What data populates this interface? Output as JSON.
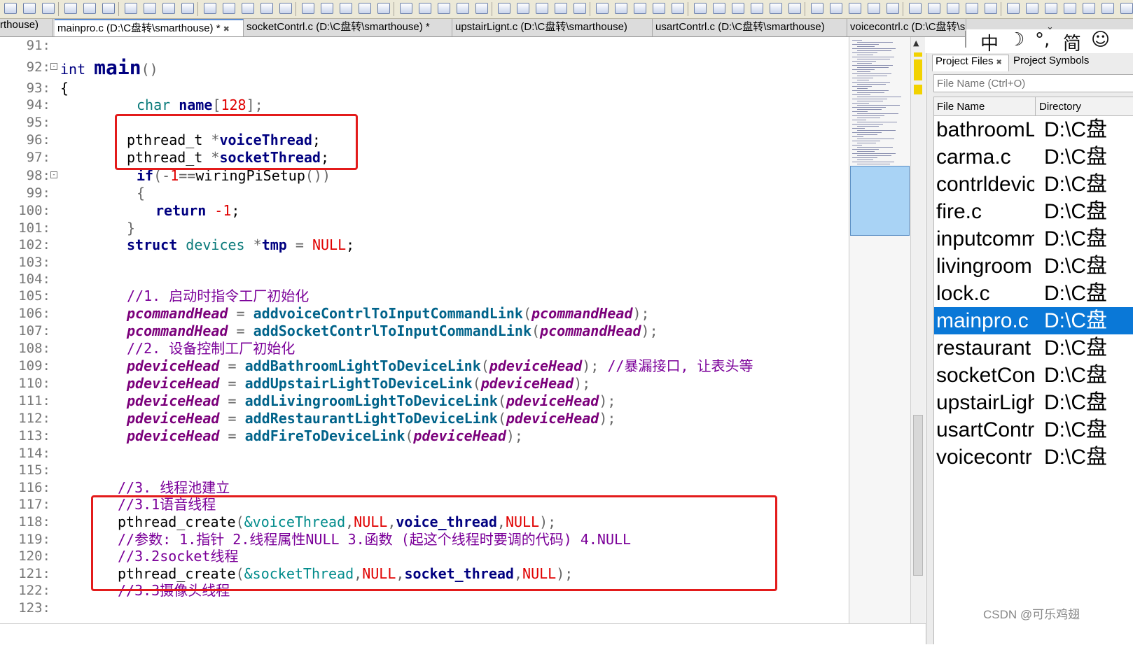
{
  "tabs": [
    {
      "label": "rthouse)",
      "active": false,
      "close": ""
    },
    {
      "label": "mainpro.c (D:\\C盘转\\smarthouse) *",
      "active": true,
      "close": "✖"
    },
    {
      "label": "socketContrl.c (D:\\C盘转\\smarthouse) *",
      "active": false,
      "close": ""
    },
    {
      "label": "upstairLignt.c (D:\\C盘转\\smarthouse)",
      "active": false,
      "close": ""
    },
    {
      "label": "usartContrl.c (D:\\C盘转\\smarthouse)",
      "active": false,
      "close": ""
    },
    {
      "label": "voicecontrl.c (D:\\C盘转\\smarthouse)",
      "active": false,
      "close": ""
    }
  ],
  "editor": {
    "line_numbers": [
      "91:",
      "92:",
      "93:",
      "94:",
      "95:",
      "96:",
      "97:",
      "98:",
      "99:",
      "100:",
      "101:",
      "102:",
      "103:",
      "104:",
      "105:",
      "106:",
      "107:",
      "108:",
      "109:",
      "110:",
      "111:",
      "112:",
      "113:",
      "114:",
      "115:",
      "116:",
      "117:",
      "118:",
      "119:",
      "120:",
      "121:",
      "122:",
      "123:"
    ],
    "code": {
      "l92": {
        "kw": "int",
        "fn": "main",
        "paren": "()"
      },
      "l93": "{",
      "l94": {
        "kw": "char",
        "id": "name",
        "br1": "[",
        "num": "128",
        "br2": "];"
      },
      "l96": {
        "ty": "pthread_t",
        "star": "*",
        "id": "voiceThread",
        "semi": ";"
      },
      "l97": {
        "ty": "pthread_t",
        "star": "*",
        "id": "socketThread",
        "semi": ";"
      },
      "l98": {
        "kw": "if",
        "p1": "(",
        "neg": "-",
        "num": "1",
        "eq": "==",
        "call": "wiringPiSetup",
        "p2": "())"
      },
      "l99": "{",
      "l100": {
        "kw": "return",
        "num": "-1",
        "semi": ";"
      },
      "l101": "}",
      "l102": {
        "kw": "struct",
        "ty": "devices",
        "star": "*",
        "id": "tmp",
        "eq": "=",
        "nul": "NULL",
        "semi": ";"
      },
      "l105": "//1. 启动时指令工厂初始化",
      "l106": {
        "v": "pcommandHead",
        "eq": "=",
        "fn": "addvoiceContrlToInputCommandLink",
        "p1": "(",
        "arg": "pcommandHead",
        "p2": ");"
      },
      "l107": {
        "v": "pcommandHead",
        "eq": "=",
        "fn": "addSocketContrlToInputCommandLink",
        "p1": "(",
        "arg": "pcommandHead",
        "p2": ");"
      },
      "l108": "//2. 设备控制工厂初始化",
      "l109": {
        "v": "pdeviceHead",
        "eq": "=",
        "fn": "addBathroomLightToDeviceLink",
        "p1": "(",
        "arg": "pdeviceHead",
        "p2": ");",
        "cmt": "//暴漏接口, 让表头等"
      },
      "l110": {
        "v": "pdeviceHead",
        "eq": "=",
        "fn": "addUpstairLightToDeviceLink",
        "p1": "(",
        "arg": "pdeviceHead",
        "p2": ");"
      },
      "l111": {
        "v": "pdeviceHead",
        "eq": "=",
        "fn": "addLivingroomLightToDeviceLink",
        "p1": "(",
        "arg": "pdeviceHead",
        "p2": ");"
      },
      "l112": {
        "v": "pdeviceHead",
        "eq": "=",
        "fn": "addRestaurantLightToDeviceLink",
        "p1": "(",
        "arg": "pdeviceHead",
        "p2": ");"
      },
      "l113": {
        "v": "pdeviceHead",
        "eq": "=",
        "fn": "addFireToDeviceLink",
        "p1": "(",
        "arg": "pdeviceHead",
        "p2": ");"
      },
      "l116": "//3. 线程池建立",
      "l117": "//3.1语音线程",
      "l118": {
        "call": "pthread_create",
        "p1": "(",
        "amp": "&voiceThread",
        "c1": ",",
        "nul1": "NULL",
        "c2": ",",
        "fn": "voice_thread",
        "c3": ",",
        "nul2": "NULL",
        "p2": ");"
      },
      "l119": "//参数: 1.指针 2.线程属性NULL 3.函数 (起这个线程时要调的代码) 4.NULL",
      "l120": "//3.2socket线程",
      "l121": {
        "call": "pthread_create",
        "p1": "(",
        "amp": "&socketThread",
        "c1": ",",
        "nul1": "NULL",
        "c2": ",",
        "fn": "socket_thread",
        "c3": ",",
        "nul2": "NULL",
        "p2": ");"
      },
      "l122": "//3.3摄像头线程"
    }
  },
  "ime": {
    "chars": [
      "中",
      "☽",
      "°,",
      "简",
      "☺"
    ]
  },
  "panel": {
    "tabs": [
      {
        "label": "Project Files",
        "close": "✖"
      },
      {
        "label": "Project Symbols",
        "close": ""
      }
    ],
    "filter_placeholder": "File Name (Ctrl+O)",
    "headers": [
      "File Name",
      "Directory"
    ],
    "files": [
      {
        "name": "bathroomL",
        "dir": "D:\\C盘",
        "selected": false
      },
      {
        "name": "carma.c",
        "dir": "D:\\C盘",
        "selected": false
      },
      {
        "name": "contrldevic",
        "dir": "D:\\C盘",
        "selected": false
      },
      {
        "name": "fire.c",
        "dir": "D:\\C盘",
        "selected": false
      },
      {
        "name": "inputcomm",
        "dir": "D:\\C盘",
        "selected": false
      },
      {
        "name": "livingroom",
        "dir": "D:\\C盘",
        "selected": false
      },
      {
        "name": "lock.c",
        "dir": "D:\\C盘",
        "selected": false
      },
      {
        "name": "mainpro.c",
        "dir": "D:\\C盘",
        "selected": true
      },
      {
        "name": "restaurant",
        "dir": "D:\\C盘",
        "selected": false
      },
      {
        "name": "socketCon",
        "dir": "D:\\C盘",
        "selected": false
      },
      {
        "name": "upstairLigh",
        "dir": "D:\\C盘",
        "selected": false
      },
      {
        "name": "usartContr",
        "dir": "D:\\C盘",
        "selected": false
      },
      {
        "name": "voicecontr",
        "dir": "D:\\C盘",
        "selected": false
      }
    ]
  },
  "watermark": "CSDN @可乐鸡翅",
  "colors": {
    "highlight_box": "#e31b1b",
    "selection": "#0a78d7"
  }
}
